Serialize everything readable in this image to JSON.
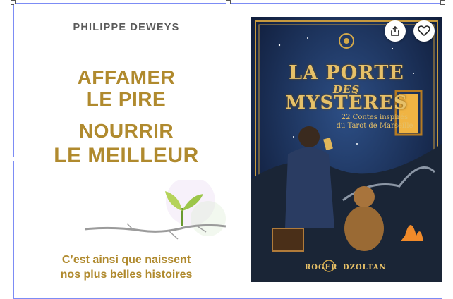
{
  "book_left": {
    "author": "PHILIPPE DEWEYS",
    "title_lines": [
      "AFFAMER",
      "LE PIRE",
      "NOURRIR",
      "LE MEILLEUR"
    ],
    "subtitle_lines": [
      "C’est ainsi que naissent",
      "nos plus belles histoires"
    ]
  },
  "book_right": {
    "title_line1": "LA PORTE",
    "title_line2": "DES",
    "title_line3": "MYSTÈRES",
    "tagline_line1": "22 Contes inspirés",
    "tagline_line2": "du Tarot de Marseille",
    "author_first": "ROGER",
    "author_last": "DZOLTAN"
  },
  "actions": {
    "share_icon": "share-icon",
    "favorite_icon": "heart-icon"
  },
  "colors": {
    "selection": "#7c8cf5",
    "gold": "#b08a2e",
    "cover_dark": "#0e1a33"
  }
}
